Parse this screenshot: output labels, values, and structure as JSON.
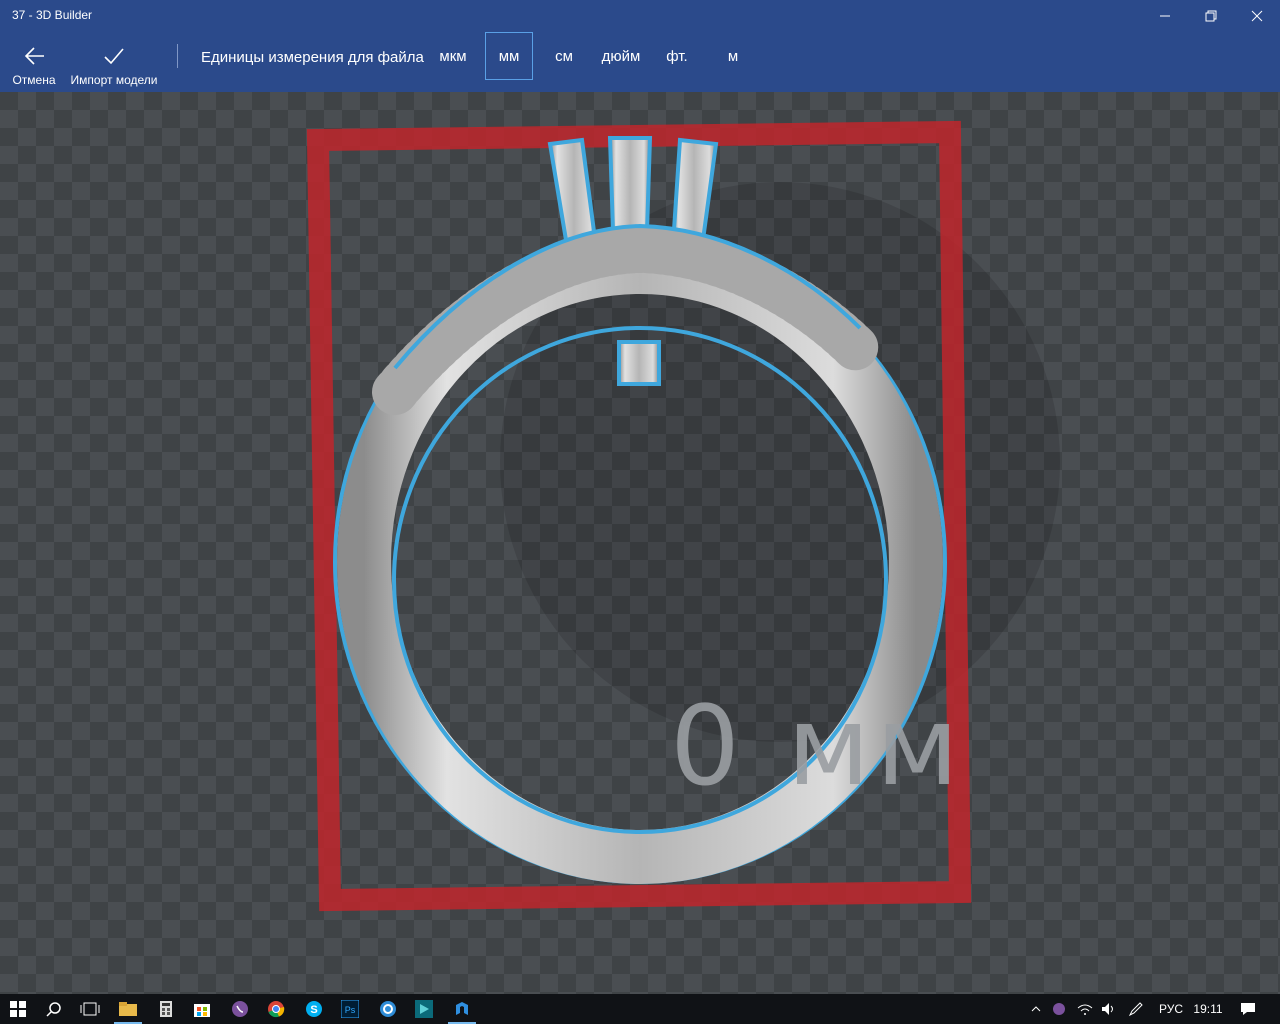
{
  "window": {
    "title": "37 - 3D Builder"
  },
  "toolbar": {
    "cancel_label": "Отмена",
    "import_label": "Импорт модели",
    "units_label": "Единицы измерения для файла",
    "units": [
      "мкм",
      "мм",
      "см",
      "дюйм",
      "фт.",
      "м"
    ],
    "selected_unit": "мм"
  },
  "viewport": {
    "size_label": "0 мм",
    "colors": {
      "bounding_box": "#c0262b",
      "selection_outline": "#3fa7dd",
      "model": "#c8c8c8"
    }
  },
  "taskbar": {
    "pinned_icons": [
      "windows-start-icon",
      "search-icon",
      "task-view-icon",
      "file-explorer-icon",
      "calculator-icon",
      "store-icon",
      "viber-icon",
      "chrome-icon",
      "skype-icon",
      "photoshop-icon",
      "app-icon",
      "media-app-icon",
      "3d-builder-icon"
    ],
    "photoshop_text": "Ps",
    "language": "РУС",
    "time": "19:11"
  }
}
